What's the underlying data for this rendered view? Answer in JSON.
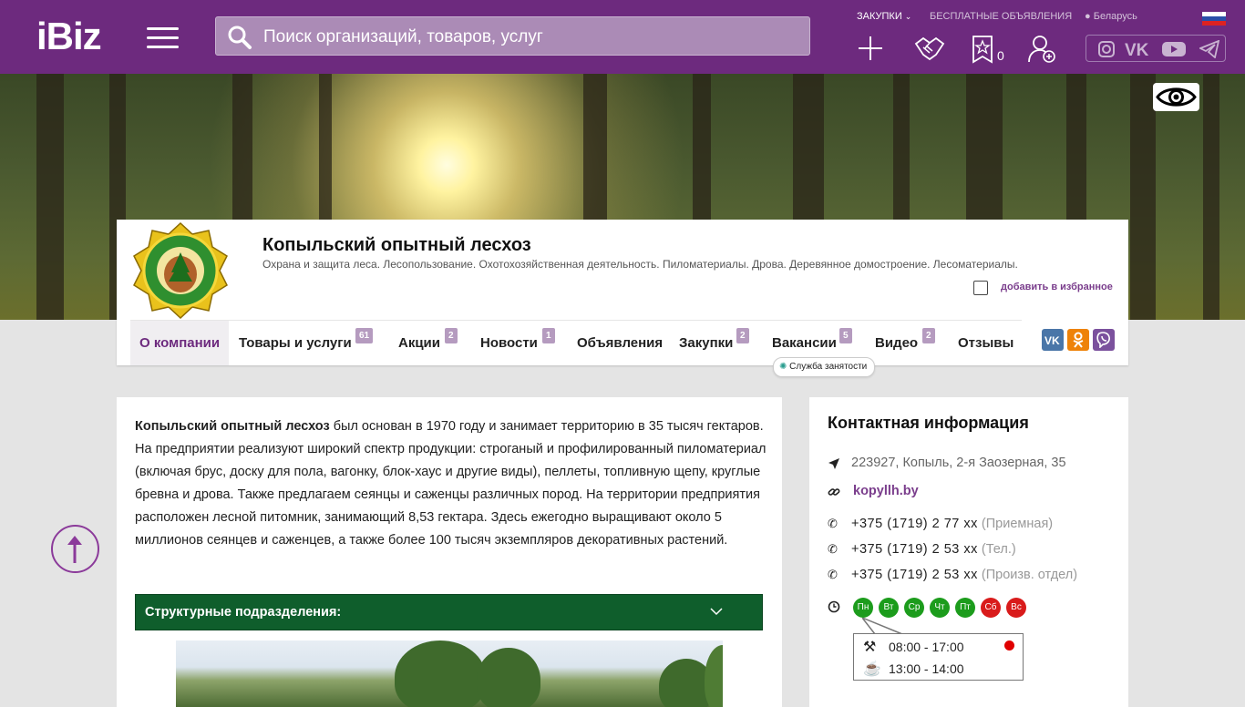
{
  "header": {
    "logo": "iBiz",
    "search_placeholder": "Поиск организаций, товаров, услуг",
    "links": {
      "purchases": "ЗАКУПКИ",
      "free_ads": "БЕСПЛАТНЫЕ ОБЪЯВЛЕНИЯ",
      "region": "Беларусь"
    },
    "favorites_count": "0"
  },
  "company": {
    "name": "Копыльский опытный лесхоз",
    "description": "Охрана и защита леса. Лесопользование. Охотохозяйственная деятельность. Пиломатериалы. Дрова. Деревянное домостроение. Лесоматериалы.",
    "add_favorite": "добавить в избранное"
  },
  "nav": {
    "tabs": [
      {
        "label": "О компании"
      },
      {
        "label": "Товары и услуги",
        "badge": "61"
      },
      {
        "label": "Акции",
        "badge": "2"
      },
      {
        "label": "Новости",
        "badge": "1"
      },
      {
        "label": "Объявления"
      },
      {
        "label": "Закупки",
        "badge": "2"
      },
      {
        "label": "Вакансии",
        "badge": "5"
      },
      {
        "label": "Видео",
        "badge": "2"
      },
      {
        "label": "Отзывы"
      }
    ],
    "employment_service": "Служба занятости"
  },
  "about": {
    "company_bold": "Копыльский опытный лесхоз",
    "text": " был основан в 1970 году и занимает территорию в 35 тысяч гектаров. На предприятии реализуют широкий спектр продукции: строганый и профилированный пиломатериал (включая брус, доску для пола, вагонку, блок-хаус и другие виды), пеллеты, топливную щепу, круглые бревна и дрова. Также предлагаем сеянцы и саженцы различных пород. На территории предприятия расположен лесной питомник, занимающий 8,53 гектара. Здесь ежегодно выращивают около 5 миллионов сеянцев и саженцев, а также более 100 тысяч экземпляров декоративных растений.",
    "structure_label": "Структурные подразделения:"
  },
  "contact": {
    "title": "Контактная информация",
    "address": "223927, Копыль, 2-я Заозерная, 35",
    "website": "kopyllh.by",
    "phones": [
      {
        "number": "+375 (1719) 2 77 xx",
        "note": "(Приемная)"
      },
      {
        "number": "+375 (1719) 2 53 xx",
        "note": "(Тел.)"
      },
      {
        "number": "+375 (1719) 2 53 xx",
        "note": "(Произв. отдел)"
      }
    ],
    "days": [
      {
        "label": "Пн",
        "status": "work"
      },
      {
        "label": "Вт",
        "status": "work"
      },
      {
        "label": "Ср",
        "status": "work"
      },
      {
        "label": "Чт",
        "status": "work"
      },
      {
        "label": "Пт",
        "status": "work"
      },
      {
        "label": "Сб",
        "status": "off"
      },
      {
        "label": "Вс",
        "status": "off"
      }
    ],
    "hours": "08:00 - 17:00",
    "break": "13:00 - 14:00"
  },
  "icons": {
    "search": "search-icon",
    "menu": "hamburger-icon",
    "add": "plus-icon",
    "handshake": "handshake-icon",
    "favorites": "star-icon",
    "account": "add-user-icon",
    "socials": [
      "instagram-icon",
      "vk-icon",
      "youtube-icon",
      "telegram-icon"
    ],
    "accessibility": "eye-icon",
    "scroll_up": "arrow-up-icon"
  },
  "colors": {
    "brand_purple": "#6d2a7e",
    "structure_green": "#0f5e2c",
    "work_day": "#1c9c1c",
    "day_off": "#d91b1b"
  }
}
